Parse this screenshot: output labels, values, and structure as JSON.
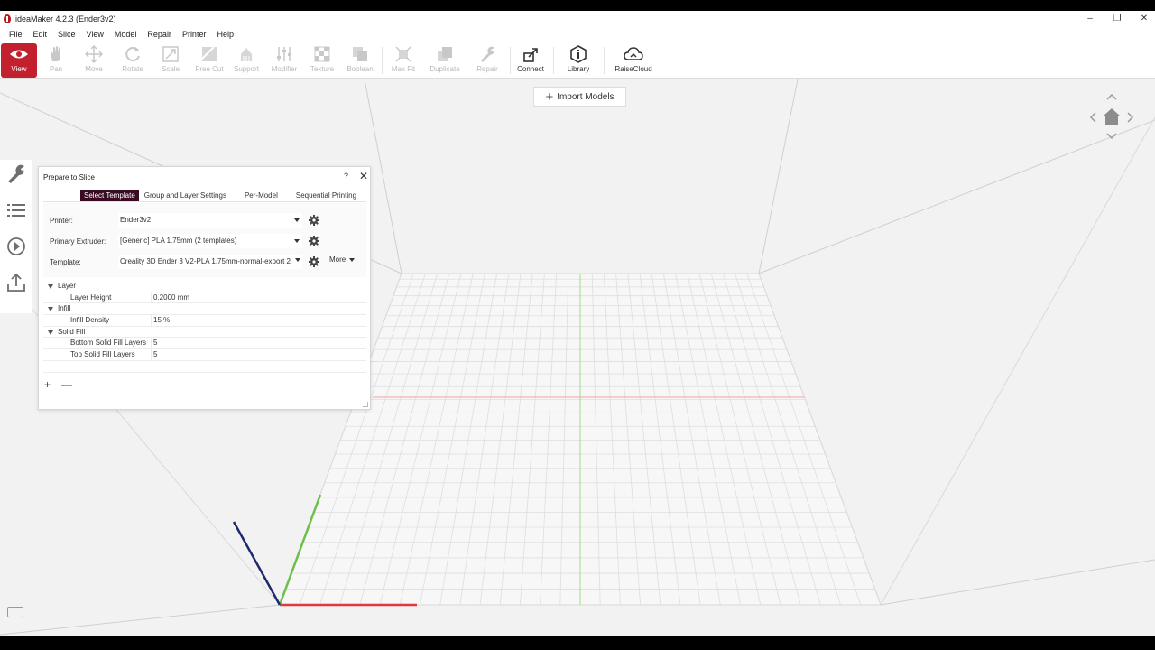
{
  "window": {
    "title": "ideaMaker 4.2.3 (Ender3v2)",
    "minimize": "–",
    "restore": "❐",
    "close": "✕"
  },
  "menu": [
    "File",
    "Edit",
    "Slice",
    "View",
    "Model",
    "Repair",
    "Printer",
    "Help"
  ],
  "toolbar": {
    "view": "View",
    "pan": "Pan",
    "move": "Move",
    "rotate": "Rotate",
    "scale": "Scale",
    "free_cut": "Free Cut",
    "support": "Support",
    "modifier": "Modifier",
    "texture": "Texture",
    "boolean": "Boolean",
    "max_fit": "Max Fit",
    "duplicate": "Duplicate",
    "repair": "Repair",
    "connect": "Connect",
    "library": "Library",
    "raisecloud": "RaiseCloud"
  },
  "import_models": "Import Models",
  "dialog": {
    "title": "Prepare to Slice",
    "help": "?",
    "close": "✕",
    "tabs": [
      "Select Template",
      "Group and Layer Settings",
      "Per-Model",
      "Sequential Printing"
    ],
    "printer_label": "Printer:",
    "printer_value": "Ender3v2",
    "extruder_label": "Primary Extruder:",
    "extruder_value": "[Generic] PLA 1.75mm (2 templates)",
    "template_label": "Template:",
    "template_value": "Creality 3D Ender 3 V2-PLA 1.75mm-normal-export 2",
    "more": "More",
    "tree": {
      "layer_group": "Layer",
      "layer_height_name": "Layer Height",
      "layer_height_value": "0.2000 mm",
      "infill_group": "Infill",
      "infill_density_name": "Infill Density",
      "infill_density_value": "15 %",
      "solid_fill_group": "Solid Fill",
      "bottom_layers_name": "Bottom Solid Fill Layers",
      "bottom_layers_value": "5",
      "top_layers_name": "Top Solid Fill Layers",
      "top_layers_value": "5"
    },
    "add": "+",
    "remove": "—"
  },
  "colors": {
    "accent": "#c3202f",
    "tab_active": "#3a0a23",
    "axis_x": "#e0383e",
    "axis_y": "#6cc04a",
    "axis_z": "#1d2a6e"
  }
}
